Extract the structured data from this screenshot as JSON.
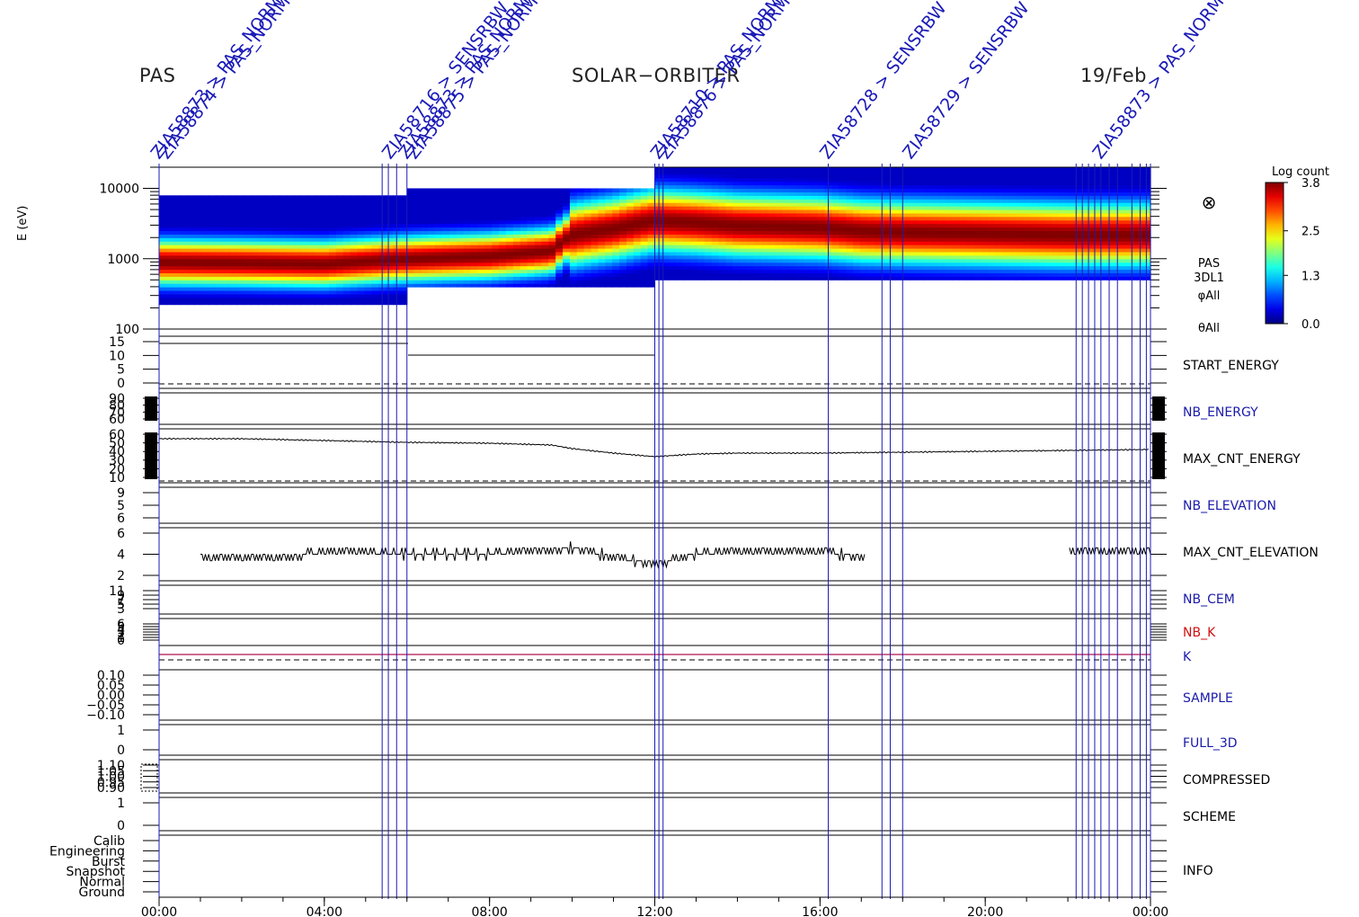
{
  "header": {
    "left": "PAS",
    "center": "SOLAR−ORBITER",
    "right": "19/Feb"
  },
  "spectrogram": {
    "ylabel": "E (eV)",
    "yticks": [
      "10000",
      "1000",
      "100"
    ],
    "label_lines": [
      "PAS",
      "3DL1",
      "φAll",
      "θAll"
    ],
    "symbol": "⊗",
    "colorbar": {
      "title": "Log count",
      "ticks": [
        "3.8",
        "2.5",
        "1.3",
        "0.0"
      ]
    }
  },
  "panels": [
    {
      "id": "start_energy",
      "label": "START_ENERGY",
      "color": "#000000",
      "ticks": [
        "15",
        "10",
        "5",
        "0"
      ]
    },
    {
      "id": "nb_energy",
      "label": "NB_ENERGY",
      "color": "#1a1aaa",
      "ticks": [
        "90",
        "80",
        "70",
        "60"
      ]
    },
    {
      "id": "max_cnt_energy",
      "label": "MAX_CNT_ENERGY",
      "color": "#000000",
      "ticks": [
        "60",
        "50",
        "40",
        "30",
        "20",
        "10"
      ]
    },
    {
      "id": "nb_elevation",
      "label": "NB_ELEVATION",
      "color": "#1a1aaa",
      "ticks": [
        "9",
        "5",
        "6"
      ]
    },
    {
      "id": "max_cnt_elevation",
      "label": "MAX_CNT_ELEVATION",
      "color": "#000000",
      "ticks": [
        "6",
        "4",
        "2"
      ]
    },
    {
      "id": "nb_cem",
      "label": "NB_CEM",
      "color": "#1a1aaa",
      "ticks": [
        "11",
        "9",
        "7",
        "5",
        "3"
      ]
    },
    {
      "id": "nb_k",
      "label": "NB_K",
      "color": "#d01010",
      "ticks": [
        "6",
        "5",
        "4",
        "3",
        "2",
        "1",
        "0"
      ]
    },
    {
      "id": "k",
      "label": "K",
      "color": "#1a1aaa",
      "ticks": []
    },
    {
      "id": "sample",
      "label": "SAMPLE",
      "color": "#1a1aaa",
      "ticks": [
        "0.10",
        "0.05",
        "0.00",
        "−0.05",
        "−0.10"
      ]
    },
    {
      "id": "full_3d",
      "label": "FULL_3D",
      "color": "#1a1aaa",
      "ticks": [
        "1",
        "0"
      ]
    },
    {
      "id": "compressed",
      "label": "COMPRESSED",
      "color": "#000000",
      "ticks": [
        "1.10",
        "1.05",
        "1.00",
        "0.95",
        "0.90"
      ]
    },
    {
      "id": "scheme",
      "label": "SCHEME",
      "color": "#000000",
      "ticks": [
        "1",
        "0"
      ]
    },
    {
      "id": "info",
      "label": "INFO",
      "color": "#000000",
      "ticks": [
        "Calib",
        "Engineering",
        "Burst",
        "Snapshot",
        "Normal",
        "Ground"
      ]
    }
  ],
  "xaxis": {
    "ticks": [
      "00:00",
      "04:00",
      "08:00",
      "12:00",
      "16:00",
      "20:00",
      "00:00"
    ]
  },
  "annotations": [
    "ZIA58873 > PAS_NORM",
    "ZIA58874 > PAS_NORM",
    "ZIA58716 > SENSRBW",
    "ZIA58873 > PAS_NORM",
    "ZIA58875 > PAS_NORM",
    "ZIA58710 > PAS_NORM",
    "ZIA58876 > PAS_NORM",
    "ZIA58728 > SENSRBW",
    "ZIA58729 > SENSRBW",
    "ZIA58873 > PAS_NORM"
  ],
  "chart_data": {
    "type": "spectrogram",
    "title": "SOLAR−ORBITER",
    "x_range_hours": [
      0,
      24
    ],
    "energy_range_eV": [
      100,
      20000
    ],
    "y_scale": "log",
    "color_range_log_count": [
      0.0,
      3.8
    ],
    "peak_energy_eV": [
      [
        0,
        900
      ],
      [
        2,
        880
      ],
      [
        4,
        850
      ],
      [
        6,
        1000
      ],
      [
        8,
        1100
      ],
      [
        9.5,
        1300
      ],
      [
        10,
        2200
      ],
      [
        11,
        2700
      ],
      [
        12,
        3500
      ],
      [
        13,
        3300
      ],
      [
        14,
        3000
      ],
      [
        15,
        2900
      ],
      [
        16,
        2800
      ],
      [
        17,
        2500
      ],
      [
        18,
        2400
      ],
      [
        20,
        2300
      ],
      [
        22,
        2200
      ],
      [
        24,
        2200
      ]
    ],
    "max_cnt_energy": [
      [
        0,
        54
      ],
      [
        2,
        54
      ],
      [
        4,
        52
      ],
      [
        6,
        50
      ],
      [
        8,
        49
      ],
      [
        9.5,
        47
      ],
      [
        10,
        43
      ],
      [
        11,
        38
      ],
      [
        12,
        34
      ],
      [
        13,
        37
      ],
      [
        14,
        38
      ],
      [
        16,
        38
      ],
      [
        18,
        39
      ],
      [
        20,
        40
      ],
      [
        22,
        41
      ],
      [
        24,
        42
      ]
    ],
    "max_cnt_elevation": [
      [
        1,
        3.5
      ],
      [
        3,
        3.5
      ],
      [
        4,
        4.5
      ],
      [
        6,
        4
      ],
      [
        8,
        4
      ],
      [
        9,
        4.5
      ],
      [
        10,
        5
      ],
      [
        11,
        3.5
      ],
      [
        12,
        2.5
      ],
      [
        13,
        4
      ],
      [
        14,
        4.5
      ],
      [
        16,
        4.5
      ],
      [
        17,
        3.5
      ],
      [
        22,
        4.5
      ],
      [
        24,
        4.5
      ]
    ],
    "event_times_hours": [
      0.0,
      5.4,
      5.55,
      5.75,
      6.0,
      12.0,
      12.1,
      12.2,
      16.2,
      17.5,
      17.7,
      18.0,
      22.2,
      22.35,
      22.5,
      22.65,
      22.8,
      23.0,
      23.2,
      23.55,
      23.75,
      23.9,
      24.0
    ]
  }
}
